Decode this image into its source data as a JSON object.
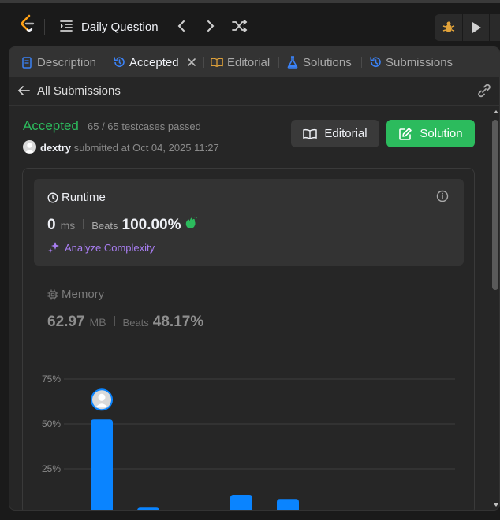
{
  "topbar": {
    "daily_question": "Daily Question",
    "icons": [
      "logo-icon",
      "list-indent-icon",
      "chevron-left-icon",
      "chevron-right-icon",
      "shuffle-icon",
      "debug-icon",
      "play-icon"
    ]
  },
  "tabs": [
    {
      "label": "Description",
      "icon": "description-icon",
      "active": false
    },
    {
      "label": "Accepted",
      "icon": "history-icon",
      "active": true
    },
    {
      "label": "Editorial",
      "icon": "book-icon",
      "active": false
    },
    {
      "label": "Solutions",
      "icon": "flask-icon",
      "active": false
    },
    {
      "label": "Submissions",
      "icon": "history-icon",
      "active": false
    }
  ],
  "subheader": {
    "back_label": "All Submissions"
  },
  "result": {
    "status": "Accepted",
    "testcases": "65 / 65 testcases passed",
    "user": "dextry",
    "submitted_text": "submitted at Oct 04, 2025 11:27",
    "editorial_button": "Editorial",
    "solution_button": "Solution"
  },
  "runtime": {
    "title": "Runtime",
    "value": "0",
    "unit": "ms",
    "beats_label": "Beats",
    "beats_value": "100.00%",
    "analyze": "Analyze Complexity"
  },
  "memory": {
    "title": "Memory",
    "value": "62.97",
    "unit": "MB",
    "beats_label": "Beats",
    "beats_value": "48.17%"
  },
  "chart_data": {
    "type": "bar",
    "ytick_labels": [
      "75%",
      "50%",
      "25%",
      "0%"
    ],
    "yticks": [
      75,
      50,
      25,
      0
    ],
    "ylim": [
      0,
      75
    ],
    "values": [
      52.5,
      3.4,
      1.8,
      10.5,
      8.2,
      0.6,
      0.6,
      0.6
    ],
    "highlight_index": 0,
    "colors": {
      "bar": "#0a84ff",
      "grid": "#3e3e3e"
    }
  },
  "colors": {
    "accepted": "#2cbb5d",
    "analyze": "#a77df0",
    "history": "#3b82f6",
    "editorial": "#e2a33a"
  }
}
